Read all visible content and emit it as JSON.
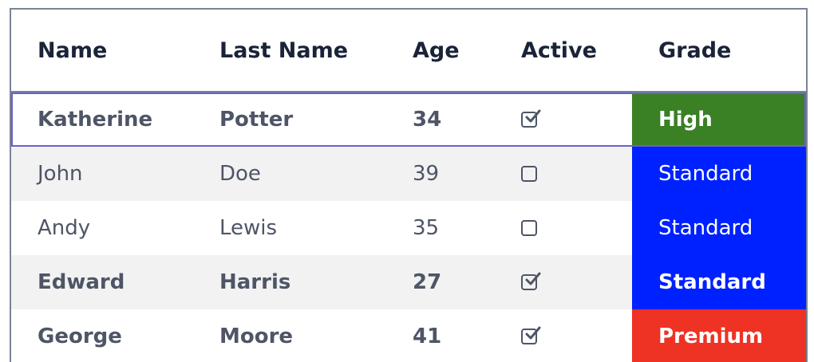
{
  "table": {
    "headers": [
      "Name",
      "Last Name",
      "Age",
      "Active",
      "Grade"
    ],
    "rows": [
      {
        "name": "Katherine",
        "last_name": "Potter",
        "age": "34",
        "active": true,
        "grade": "High",
        "grade_color": "#3a8024",
        "bold": true,
        "selected": true,
        "alt": false
      },
      {
        "name": "John",
        "last_name": "Doe",
        "age": "39",
        "active": false,
        "grade": "Standard",
        "grade_color": "#0021ff",
        "bold": false,
        "selected": false,
        "alt": true
      },
      {
        "name": "Andy",
        "last_name": "Lewis",
        "age": "35",
        "active": false,
        "grade": "Standard",
        "grade_color": "#0021ff",
        "bold": false,
        "selected": false,
        "alt": false
      },
      {
        "name": "Edward",
        "last_name": "Harris",
        "age": "27",
        "active": true,
        "grade": "Standard",
        "grade_color": "#0021ff",
        "bold": true,
        "selected": false,
        "alt": true
      },
      {
        "name": "George",
        "last_name": "Moore",
        "age": "41",
        "active": true,
        "grade": "Premium",
        "grade_color": "#ee3224",
        "bold": true,
        "selected": false,
        "alt": false
      }
    ]
  },
  "colors": {
    "border": "#7a8396",
    "selection": "#6b61c7",
    "header_text": "#1a2338",
    "cell_text": "#4e5566",
    "alt_row": "#f2f2f2"
  }
}
